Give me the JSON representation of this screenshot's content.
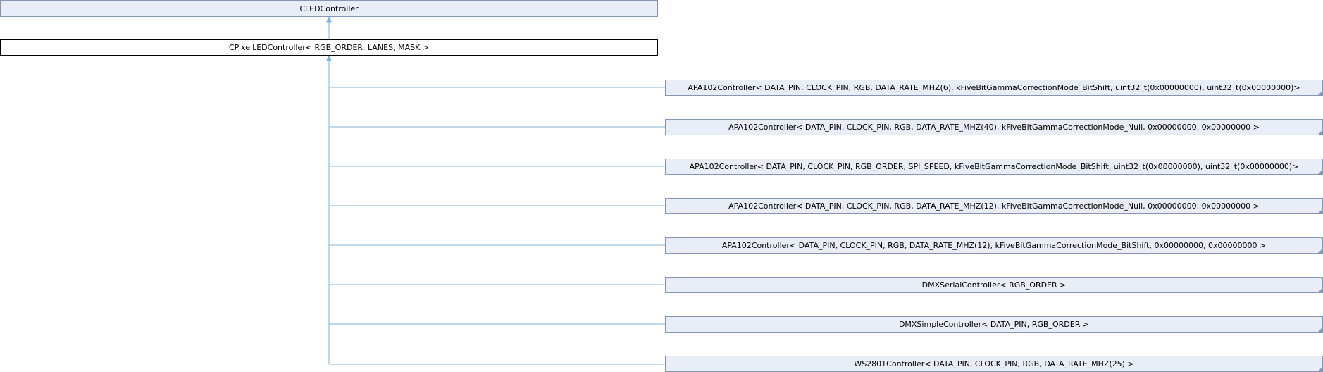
{
  "diagram": {
    "base": {
      "label": "CLEDController"
    },
    "current": {
      "label": "CPixelLEDController< RGB_ORDER, LANES, MASK >"
    },
    "children": [
      {
        "label": "APA102Controller< DATA_PIN, CLOCK_PIN, RGB, DATA_RATE_MHZ(6), kFiveBitGammaCorrectionMode_BitShift, uint32_t(0x00000000), uint32_t(0x00000000)>"
      },
      {
        "label": "APA102Controller< DATA_PIN, CLOCK_PIN, RGB, DATA_RATE_MHZ(40), kFiveBitGammaCorrectionMode_Null, 0x00000000, 0x00000000 >"
      },
      {
        "label": "APA102Controller< DATA_PIN, CLOCK_PIN, RGB_ORDER, SPI_SPEED, kFiveBitGammaCorrectionMode_BitShift, uint32_t(0x00000000), uint32_t(0x00000000)>"
      },
      {
        "label": "APA102Controller< DATA_PIN, CLOCK_PIN, RGB, DATA_RATE_MHZ(12), kFiveBitGammaCorrectionMode_Null, 0x00000000, 0x00000000 >"
      },
      {
        "label": "APA102Controller< DATA_PIN, CLOCK_PIN, RGB, DATA_RATE_MHZ(12), kFiveBitGammaCorrectionMode_BitShift, 0x00000000, 0x00000000 >"
      },
      {
        "label": "DMXSerialController< RGB_ORDER >"
      },
      {
        "label": "DMXSimpleController< DATA_PIN, RGB_ORDER >"
      },
      {
        "label": "WS2801Controller< DATA_PIN, CLOCK_PIN, RGB, DATA_RATE_MHZ(25) >"
      }
    ]
  }
}
